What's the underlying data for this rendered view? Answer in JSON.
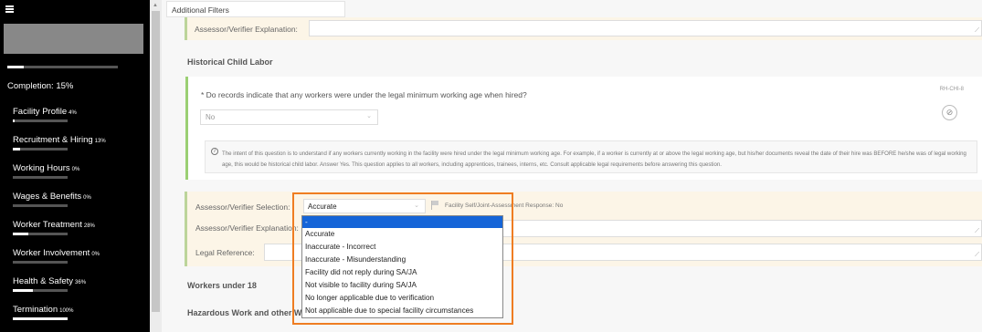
{
  "sidebar": {
    "overall_progress": 0.15,
    "completion": "Completion: 15%",
    "items": [
      {
        "label": "Facility Profile",
        "pct": "4%",
        "progress": 0.04,
        "active": false
      },
      {
        "label": "Recruitment & Hiring",
        "pct": "13%",
        "progress": 0.13,
        "active": true
      },
      {
        "label": "Working Hours",
        "pct": "0%",
        "progress": 0.0,
        "active": false
      },
      {
        "label": "Wages & Benefits",
        "pct": "0%",
        "progress": 0.0,
        "active": false
      },
      {
        "label": "Worker Treatment",
        "pct": "28%",
        "progress": 0.28,
        "active": false
      },
      {
        "label": "Worker Involvement",
        "pct": "0%",
        "progress": 0.0,
        "active": false
      },
      {
        "label": "Health & Safety",
        "pct": "36%",
        "progress": 0.36,
        "active": false
      },
      {
        "label": "Termination",
        "pct": "100%",
        "progress": 1.0,
        "active": false
      }
    ]
  },
  "toolbar": {
    "additional_filters": "Additional Filters"
  },
  "top_row": {
    "explanation_label": "Assessor/Verifier Explanation:"
  },
  "section": {
    "historical_title": "Historical Child Labor",
    "workers_under_18": "Workers under 18",
    "hazardous_partial": "Hazardous Work and other W"
  },
  "question": {
    "text": "* Do records indicate that any workers were under the legal minimum working age when hired?",
    "code": "RH-CHI-8",
    "answer": "No",
    "info": "The intent of this question is to understand if any workers currently working in the facility were hired under the legal minimum working age. For example, if a worker is currently at or above the legal working age, but his/her documents reveal the date of their hire was BEFORE he/she was of legal working age, this would be historical child labor. Answer Yes. This question applies to all workers, including apprentices, trainees, interns, etc. Consult applicable legal requirements before answering this question."
  },
  "assessment": {
    "selection_label": "Assessor/Verifier Selection:",
    "selected": "Accurate",
    "fsa_label": "Facility Self/Joint-Assessment Response:",
    "fsa_value": "No",
    "explanation_label": "Assessor/Verifier Explanation:",
    "legal_label": "Legal Reference:"
  },
  "dropdown": {
    "options": [
      "-",
      "Accurate",
      "Inaccurate - Incorrect",
      "Inaccurate - Misunderstanding",
      "Facility did not reply during SA/JA",
      "Not visible to facility during SA/JA",
      "No longer applicable due to verification",
      "Not applicable due to special facility circumstances"
    ],
    "highlighted_index": 0
  },
  "colors": {
    "sidebar_bg": "#000000",
    "active_item": "#b31217",
    "highlight_frame": "#ef7d22",
    "option_highlight": "#1565d8",
    "card_border": "#9bcf73"
  }
}
